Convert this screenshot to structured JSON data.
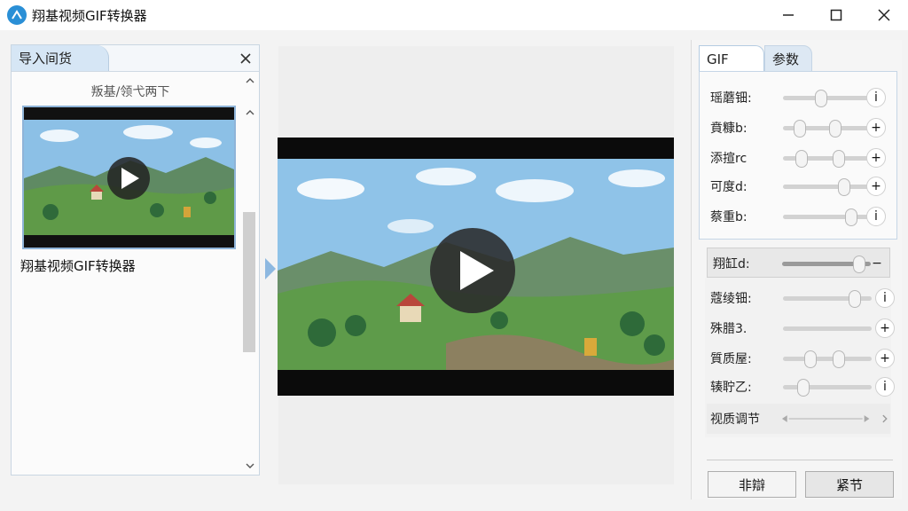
{
  "window": {
    "title": "翔基视频GIF转换器",
    "controls": [
      "minimize",
      "maximize",
      "close"
    ]
  },
  "left_panel": {
    "tab_label": "导入间货",
    "caption": "叛基/领弋两下",
    "file_name": "翔基视频GIF转换器"
  },
  "right_panel": {
    "tabs": [
      "GIF",
      "参数"
    ],
    "rows": [
      {
        "label": "瑶蘑钿:",
        "action": "i"
      },
      {
        "label": "賁糠b:",
        "action": "+"
      },
      {
        "label": "添揎rc",
        "action": "+"
      },
      {
        "label": "可度d:",
        "action": "+"
      },
      {
        "label": "蔡重b:",
        "action": "i"
      }
    ],
    "highlight_row": {
      "label": "翔缸d:",
      "action": "−"
    },
    "lower_rows": [
      {
        "label": "蔻绫钿:",
        "action": "i"
      },
      {
        "label": "殊腊3.",
        "action": "+"
      },
      {
        "label": "質质屋:",
        "action": "+"
      },
      {
        "label": "辏聍乙:",
        "action": "i"
      }
    ],
    "zoom_label": "视质调节",
    "buttons": {
      "left": "非辯",
      "right": "紧节"
    }
  },
  "colors": {
    "accent": "#2a8fd6",
    "tab_active": "#d6e6f5",
    "border": "#c6d6e6"
  }
}
